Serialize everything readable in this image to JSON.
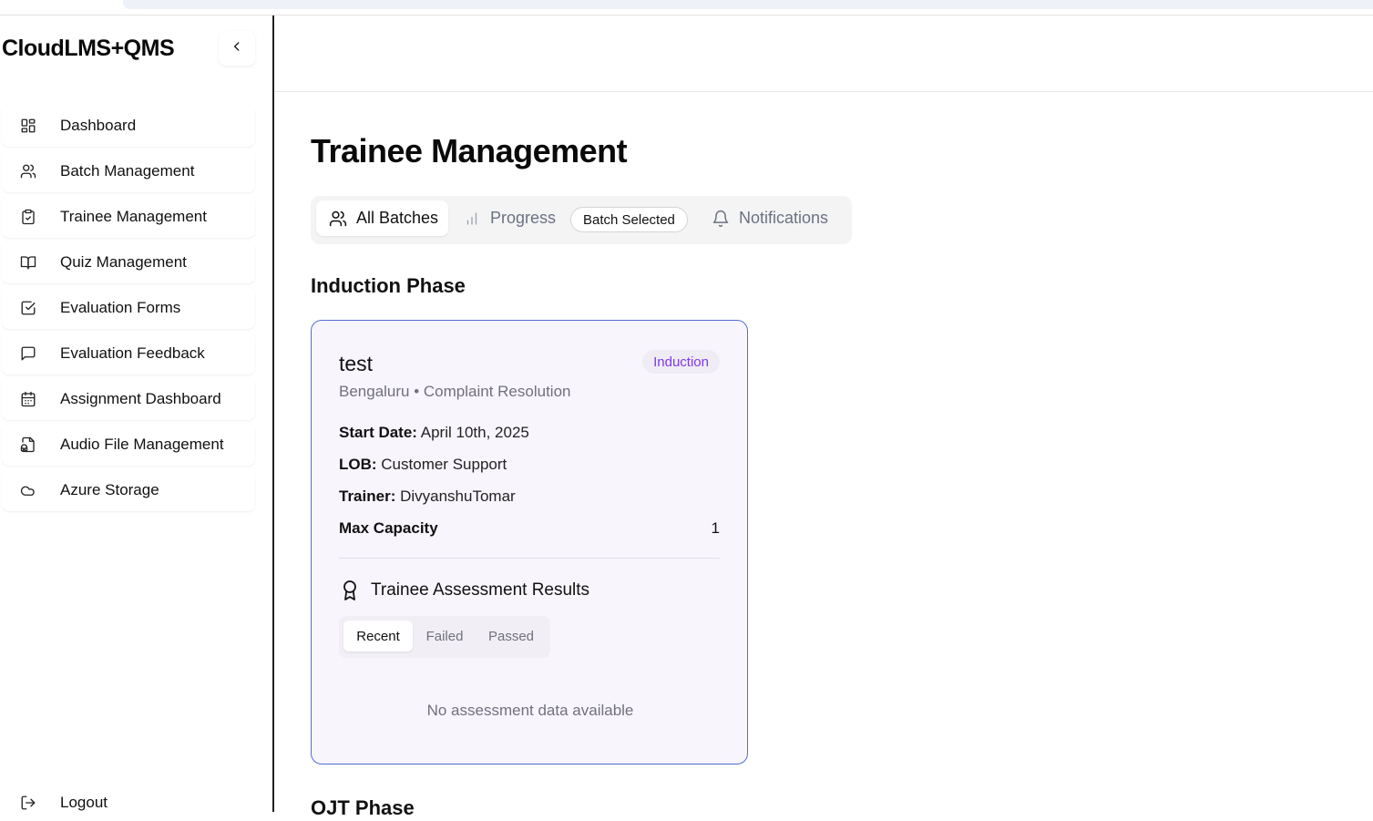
{
  "app": {
    "brand": "CloudLMS+QMS"
  },
  "sidebar": {
    "items": [
      {
        "label": "Dashboard",
        "icon": "grid-icon"
      },
      {
        "label": "Batch Management",
        "icon": "users-icon"
      },
      {
        "label": "Trainee Management",
        "icon": "clipboard-check-icon"
      },
      {
        "label": "Quiz Management",
        "icon": "book-open-icon"
      },
      {
        "label": "Evaluation Forms",
        "icon": "check-square-icon"
      },
      {
        "label": "Evaluation Feedback",
        "icon": "message-square-icon"
      },
      {
        "label": "Assignment Dashboard",
        "icon": "calendar-icon"
      },
      {
        "label": "Audio File Management",
        "icon": "file-audio-icon"
      },
      {
        "label": "Azure Storage",
        "icon": "cloud-icon"
      }
    ],
    "logout_label": "Logout"
  },
  "main": {
    "title": "Trainee Management",
    "tabs": {
      "all_batches": "All Batches",
      "progress": "Progress",
      "batch_selected": "Batch Selected",
      "notifications": "Notifications"
    },
    "sections": {
      "induction": "Induction Phase",
      "ojt": "OJT Phase"
    },
    "batch_card": {
      "name": "test",
      "phase_badge": "Induction",
      "location_process": "Bengaluru • Complaint Resolution",
      "start_date_label": "Start Date:",
      "start_date": "April 10th, 2025",
      "lob_label": "LOB:",
      "lob": "Customer Support",
      "trainer_label": "Trainer:",
      "trainer": "DivyanshuTomar",
      "capacity_label": "Max Capacity",
      "capacity": "1",
      "assessment_title": "Trainee Assessment Results",
      "result_tabs": {
        "recent": "Recent",
        "failed": "Failed",
        "passed": "Passed"
      },
      "empty_message": "No assessment data available"
    }
  },
  "colors": {
    "accent_purple": "#7c3aed",
    "card_border": "#4f6fd1",
    "card_bg": "#f8f5fd"
  }
}
